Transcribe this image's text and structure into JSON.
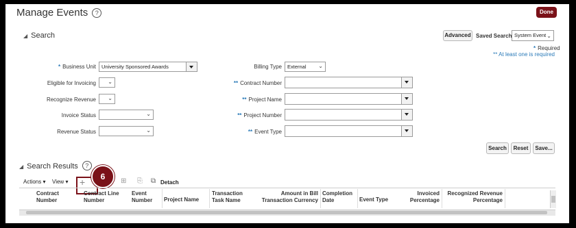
{
  "page": {
    "title": "Manage Events",
    "done_label": "Done"
  },
  "search": {
    "header": "Search",
    "advanced_label": "Advanced",
    "saved_search_label": "Saved Search",
    "saved_search_value": "System Event",
    "required_note": "Required",
    "at_least_one_note": "** At least one is required",
    "required_marker": "*",
    "atleast_marker": "**",
    "business_unit_label": "Business Unit",
    "business_unit_value": "University Sponsored Awards",
    "eligible_label": "Eligible for Invoicing",
    "recognize_revenue_label": "Recognize Revenue",
    "invoice_status_label": "Invoice Status",
    "revenue_status_label": "Revenue Status",
    "billing_type_label": "Billing Type",
    "billing_type_value": "External",
    "contract_number_label": "Contract Number",
    "project_name_label": "Project Name",
    "project_number_label": "Project Number",
    "event_type_label": "Event Type",
    "search_btn": "Search",
    "reset_btn": "Reset",
    "save_btn": "Save..."
  },
  "results": {
    "header": "Search Results",
    "actions_label": "Actions",
    "view_label": "View",
    "detach_label": "Detach",
    "callout_number": "6",
    "columns": [
      [
        "Contract",
        "Number"
      ],
      [
        "Contract Line",
        "Number"
      ],
      [
        "Event",
        "Number"
      ],
      [
        "Project Name",
        ""
      ],
      [
        "Transaction",
        "Task Name"
      ],
      [
        "Amount in Bill",
        "Transaction Currency"
      ],
      [
        "Completion",
        "Date"
      ],
      [
        "Event Type",
        ""
      ],
      [
        "Invoiced",
        "Percentage"
      ],
      [
        "Recognized Revenue",
        "Percentage"
      ]
    ]
  }
}
